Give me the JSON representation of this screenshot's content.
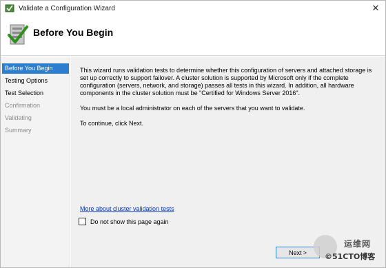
{
  "window": {
    "title": "Validate a Configuration Wizard",
    "close_glyph": "✕"
  },
  "header": {
    "title": "Before You Begin",
    "icon": "wizard-checkmark-icon"
  },
  "steps": [
    {
      "label": "Before You Begin",
      "state": "active"
    },
    {
      "label": "Testing Options",
      "state": "done"
    },
    {
      "label": "Test Selection",
      "state": "done"
    },
    {
      "label": "Confirmation",
      "state": "disabled"
    },
    {
      "label": "Validating",
      "state": "disabled"
    },
    {
      "label": "Summary",
      "state": "disabled"
    }
  ],
  "content": {
    "intro": "This wizard runs validation tests to determine whether this configuration of servers and attached storage is set up correctly to support failover. A cluster solution is supported by Microsoft only if the complete configuration (servers, network, and storage) passes all tests in this wizard. In addition, all hardware components in the cluster solution must be \"Certified for Windows Server 2016\".",
    "admin_note": "You must be a local administrator on each of the servers that you want to validate.",
    "continue_note": "To continue, click Next.",
    "link_text": "More about cluster validation tests",
    "checkbox_label": "Do not show this page again",
    "checkbox_checked": false
  },
  "buttons": {
    "next_label": "Next",
    "next_glyph": ">"
  },
  "watermark": {
    "top_text": "运维网",
    "bottom_text": "©51CTO博客"
  },
  "colors": {
    "accent": "#2e7ed0",
    "link": "#0033cc",
    "disabled_text": "#8c8c8c",
    "panel_bg": "#f0f0f0"
  }
}
